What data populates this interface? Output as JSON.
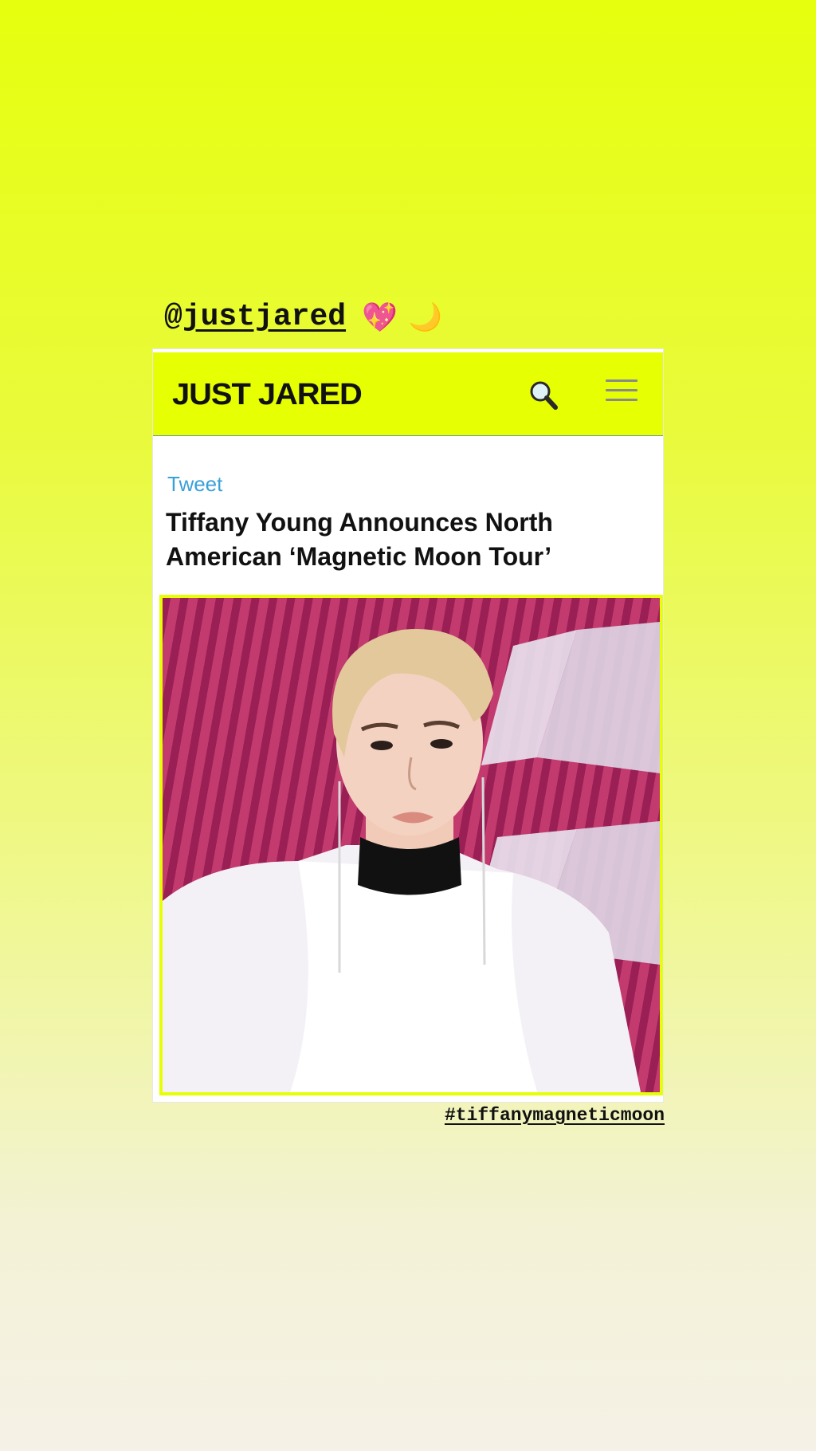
{
  "story": {
    "mention_prefix": "@",
    "mention_handle": "justjared",
    "emoji_heart": "💖",
    "emoji_moon": "🌙",
    "hashtag": "#tiffanymagneticmoon"
  },
  "site": {
    "logo": "JUST JARED",
    "search_icon": "search-icon",
    "menu_icon": "hamburger-menu-icon",
    "accent_color": "#e6ff03"
  },
  "article": {
    "tweet_label": "Tweet",
    "headline": "Tiffany Young Announces North American ‘Magnetic Moon Tour’",
    "image_alt": "photo"
  }
}
